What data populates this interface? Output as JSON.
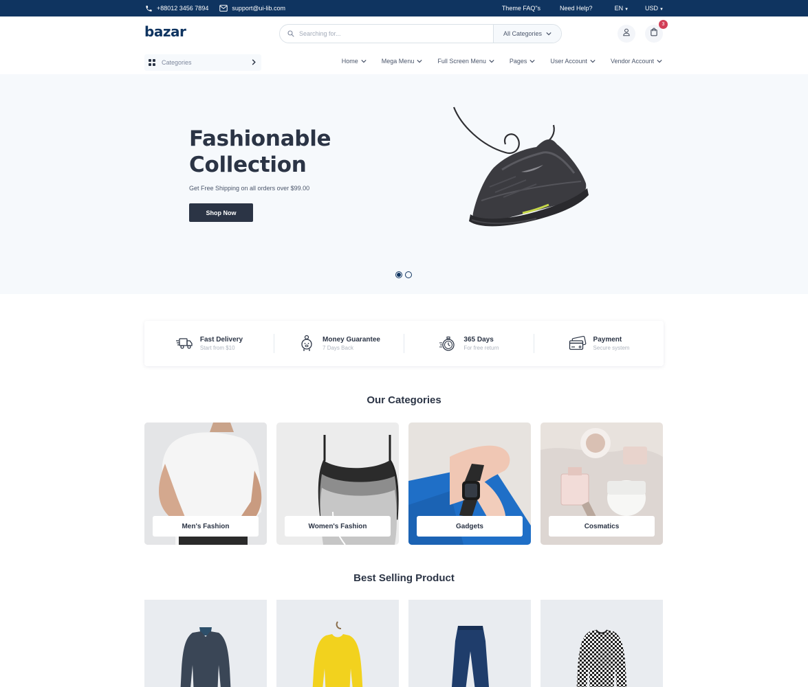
{
  "topbar": {
    "phone": "+88012 3456 7894",
    "email": "support@ui-lib.com",
    "faq": "Theme FAQ\"s",
    "help": "Need Help?",
    "language": "EN",
    "currency": "USD"
  },
  "header": {
    "logo": "bazar",
    "search_placeholder": "Searching for...",
    "search_category": "All Categories",
    "cart_count": "3"
  },
  "nav": {
    "categories_label": "Categories",
    "items": [
      {
        "label": "Home"
      },
      {
        "label": "Mega Menu"
      },
      {
        "label": "Full Screen Menu"
      },
      {
        "label": "Pages"
      },
      {
        "label": "User Account"
      },
      {
        "label": "Vendor Account"
      }
    ]
  },
  "hero": {
    "title_line1": "Fashionable",
    "title_line2": "Collection",
    "subtitle": "Get Free Shipping on all orders over $99.00",
    "button": "Shop Now",
    "slides": 2,
    "active_slide": 1
  },
  "services": [
    {
      "title": "Fast Delivery",
      "subtitle": "Start from $10",
      "icon": "truck-icon"
    },
    {
      "title": "Money Guarantee",
      "subtitle": "7 Days Back",
      "icon": "piggy-bank-icon"
    },
    {
      "title": "365 Days",
      "subtitle": "For free return",
      "icon": "stopwatch-icon"
    },
    {
      "title": "Payment",
      "subtitle": "Secure system",
      "icon": "credit-card-icon"
    }
  ],
  "categories": {
    "title": "Our Categories",
    "items": [
      {
        "label": "Men's Fashion"
      },
      {
        "label": "Women's Fashion"
      },
      {
        "label": "Gadgets"
      },
      {
        "label": "Cosmatics"
      }
    ]
  },
  "best_selling": {
    "title": "Best Selling Product"
  },
  "colors": {
    "primary": "#0f3460",
    "dark": "#2b3445",
    "accent": "#d23f57",
    "hero_bg": "#f6f9fc"
  }
}
